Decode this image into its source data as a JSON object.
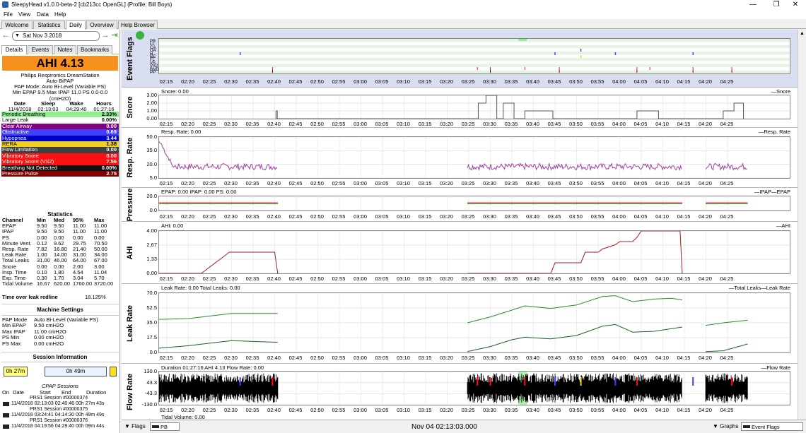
{
  "window": {
    "title": "SleepyHead v1.0.0-beta-2 [cb213cc OpenGL] (Profile: Bill Boys)",
    "minimize": "—",
    "maximize": "❐",
    "close": "✕"
  },
  "menu": [
    "File",
    "View",
    "Data",
    "Help"
  ],
  "tabs": [
    "Welcome",
    "Statistics",
    "Daily",
    "Overview",
    "Help Browser"
  ],
  "active_tab": "Daily",
  "date_nav": {
    "prev": "←",
    "date": "Sat Nov 3 2018",
    "next": "→",
    "jump": "⇥"
  },
  "subtabs": [
    "Details",
    "Events",
    "Notes",
    "Bookmarks"
  ],
  "ahi": {
    "text": "AHI 4.13",
    "color": "#f7901e"
  },
  "machine": {
    "name": "Philips Respironics DreamStation",
    "type": "Auto BiPAP",
    "mode": "PAP Mode: Auto Bi-Level (Variable PS)",
    "pressure": "Min EPAP 9.5 Max IPAP 11.0 PS 0.0-0.0 (cmH2O)"
  },
  "times": {
    "headers": [
      "Date",
      "Sleep",
      "Wake",
      "Hours"
    ],
    "values": [
      "11/4/2018",
      "02:13:03",
      "04:29:40",
      "01:27:16"
    ]
  },
  "indices": [
    {
      "label": "Periodic Breathing",
      "value": "2.33%",
      "bg": "#90ee90",
      "fg": "#000000"
    },
    {
      "label": "Large Leak",
      "value": "0.00%",
      "bg": "#ffffff",
      "fg": "#000000"
    },
    {
      "label": "Clear Airway",
      "value": "0.00",
      "bg": "#800080",
      "fg": "#ffffff"
    },
    {
      "label": "Obstructive",
      "value": "0.69",
      "bg": "#4040ff",
      "fg": "#ffffff"
    },
    {
      "label": "Hypopnea",
      "value": "3.44",
      "bg": "#0000c0",
      "fg": "#ffffff"
    },
    {
      "label": "RERA",
      "value": "1.38",
      "bg": "#f0d020",
      "fg": "#000000"
    },
    {
      "label": "Flow Limitation",
      "value": "0.00",
      "bg": "#404040",
      "fg": "#ffffff"
    },
    {
      "label": "Vibratory Snore",
      "value": "0.00",
      "bg": "#ff1010",
      "fg": "#ffffff"
    },
    {
      "label": "Vibratory Snore (VS2)",
      "value": "7.56",
      "bg": "#ff1010",
      "fg": "#ffffff"
    },
    {
      "label": "Breathing Not Detected",
      "value": "0.00%",
      "bg": "#101010",
      "fg": "#ffffff"
    },
    {
      "label": "Pressure Pulse",
      "value": "2.75",
      "bg": "#800000",
      "fg": "#ffffff"
    }
  ],
  "statistics": {
    "title": "Statistics",
    "headers": [
      "Channel",
      "Min",
      "Med",
      "95%",
      "Max"
    ],
    "rows": [
      [
        "EPAP",
        "9.50",
        "9.50",
        "11.00",
        "11.00"
      ],
      [
        "IPAP",
        "9.50",
        "9.50",
        "11.00",
        "11.00"
      ],
      [
        "PS",
        "0.00",
        "0.00",
        "0.00",
        "0.00"
      ],
      [
        "Minute Vent.",
        "0.12",
        "9.62",
        "29.75",
        "70.50"
      ],
      [
        "Resp. Rate",
        "7.82",
        "16.80",
        "21.40",
        "50.00"
      ],
      [
        "Leak Rate",
        "1.00",
        "14.00",
        "31.00",
        "34.00"
      ],
      [
        "Total Leaks",
        "31.00",
        "46.00",
        "64.00",
        "67.00"
      ],
      [
        "Snore",
        "0.00",
        "0.00",
        "2.00",
        "3.00"
      ],
      [
        "Insp. Time",
        "0.10",
        "1.80",
        "4.54",
        "11.04"
      ],
      [
        "Exp. Time",
        "0.30",
        "1.70",
        "3.04",
        "5.70"
      ],
      [
        "Tidal Volume",
        "16.67",
        "620.00",
        "1760.00",
        "3720.00"
      ]
    ]
  },
  "leak_redline": {
    "label": "Time over leak redline",
    "value": "18.125%"
  },
  "machine_settings": {
    "title": "Machine Settings",
    "rows": [
      [
        "PAP Mode",
        "Auto Bi-Level (Variable PS)"
      ],
      [
        "Min EPAP",
        "9.50 cmH2O"
      ],
      [
        "Max IPAP",
        "11.00 cmH2O"
      ],
      [
        "PS Min",
        "0.00 cmH2O"
      ],
      [
        "PS Max",
        "0.00 cmH2O"
      ]
    ]
  },
  "session_info": {
    "title": "Session Information",
    "left": "0h 27m",
    "mid": "0h 49m"
  },
  "cpap_sessions": {
    "title": "CPAP Sessions",
    "headers": [
      "On",
      "Date",
      "Start",
      "End",
      "Duration"
    ],
    "rows": [
      {
        "name": "PRS1 Session #00000374",
        "detail": "11/4/2018 02:13:03 02:40:46 00h 27m 43s"
      },
      {
        "name": "PRS1 Session #00000375",
        "detail": "11/4/2018 03:24:41 04:14:30 00h 49m 49s"
      },
      {
        "name": "PRS1 Session #00000376",
        "detail": "11/4/2018 04:19:56 04:29:40 00h 09m 44s"
      }
    ]
  },
  "x_ticks": [
    "02:15",
    "02:20",
    "02:25",
    "02:30",
    "02:35",
    "02:40",
    "02:45",
    "02:50",
    "02:55",
    "03:00",
    "03:05",
    "03:10",
    "03:15",
    "03:20",
    "03:25",
    "03:30",
    "03:35",
    "03:40",
    "03:45",
    "03:50",
    "03:55",
    "04:00",
    "04:05",
    "04:10",
    "04:15",
    "04:20",
    "04:25"
  ],
  "graphs": {
    "event_flags": {
      "title": "Event Flags",
      "labels": [
        "PB",
        "LL",
        "CA",
        "OA",
        "H",
        "RE",
        "FL",
        "VS",
        "VS2",
        "BND",
        "PP"
      ]
    },
    "snore": {
      "title": "Snore",
      "info": "Snore: 0.00",
      "legend": "—Snore",
      "yticks": [
        "3.00",
        "2.00",
        "1.00",
        "0.00"
      ]
    },
    "resp": {
      "title": "Resp. Rate",
      "info": "Resp. Rate: 0.00",
      "legend": "—Resp. Rate",
      "yticks": [
        "50.0",
        "35.0",
        "20.0",
        "5.0"
      ]
    },
    "pressure": {
      "title": "Pressure",
      "info": "EPAP: 0.00 IPAP: 0.00 PS: 0.00",
      "legend": "—IPAP—EPAP",
      "yticks": [
        "20.0",
        "0.0"
      ]
    },
    "ahi": {
      "title": "AHI",
      "info": "AHI: 0.00",
      "legend": "—AHI",
      "yticks": [
        "4.00",
        "2.67",
        "1.33",
        "0.00"
      ]
    },
    "leak": {
      "title": "Leak Rate",
      "info": "Leak Rate: 0.00 Total Leaks: 0.00",
      "legend": "—Total Leaks—Leak Rate",
      "yticks": [
        "70.0",
        "52.5",
        "35.0",
        "17.5",
        "0.0"
      ]
    },
    "flow": {
      "title": "Flow Rate",
      "info": "Duration 01:27:16 AHI 4.13 Flow Rate: 0.00",
      "legend": "—Flow Rate",
      "yticks": [
        "130.0",
        "43.3",
        "-43.3",
        "-130.0"
      ]
    },
    "tidal": {
      "info": "Tidal Volume: 0.00"
    }
  },
  "bottom": {
    "flags": "Flags",
    "flag_combo": "PB",
    "time": "Nov 04 02:13:03.000",
    "graphs": "Graphs",
    "graph_combo": "Event Flags"
  }
}
